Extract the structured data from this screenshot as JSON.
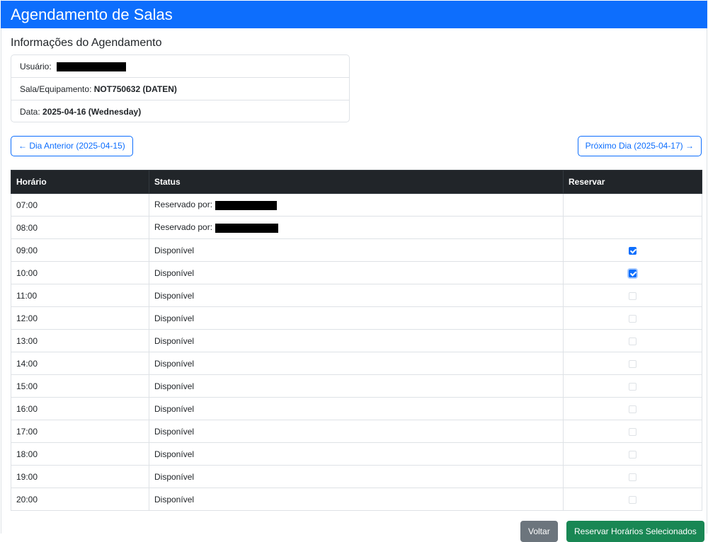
{
  "header": {
    "title": "Agendamento de Salas"
  },
  "info": {
    "section_title": "Informações do Agendamento",
    "user_label": "Usuário:",
    "room_label": "Sala/Equipamento:",
    "room_value": "NOT750632 (DATEN)",
    "date_label": "Data:",
    "date_value": "2025-04-16 (Wednesday)"
  },
  "nav": {
    "prev_label": "← Dia Anterior (2025-04-15)",
    "next_label": "Próximo Dia (2025-04-17) →"
  },
  "table": {
    "headers": [
      "Horário",
      "Status",
      "Reservar"
    ],
    "rows": [
      {
        "time": "07:00",
        "status": "Reservado por:",
        "reserved": true
      },
      {
        "time": "08:00",
        "status": "Reservado por:",
        "reserved": true
      },
      {
        "time": "09:00",
        "status": "Disponível",
        "checked": true
      },
      {
        "time": "10:00",
        "status": "Disponível",
        "checked": true
      },
      {
        "time": "11:00",
        "status": "Disponível",
        "checked": false
      },
      {
        "time": "12:00",
        "status": "Disponível",
        "checked": false
      },
      {
        "time": "13:00",
        "status": "Disponível",
        "checked": false
      },
      {
        "time": "14:00",
        "status": "Disponível",
        "checked": false
      },
      {
        "time": "15:00",
        "status": "Disponível",
        "checked": false
      },
      {
        "time": "16:00",
        "status": "Disponível",
        "checked": false
      },
      {
        "time": "17:00",
        "status": "Disponível",
        "checked": false
      },
      {
        "time": "18:00",
        "status": "Disponível",
        "checked": false
      },
      {
        "time": "19:00",
        "status": "Disponível",
        "checked": false
      },
      {
        "time": "20:00",
        "status": "Disponível",
        "checked": false
      }
    ]
  },
  "actions": {
    "back_label": "Voltar",
    "submit_label": "Reservar Horários Selecionados"
  },
  "colors": {
    "primary": "#0d6efd",
    "table_header": "#212529",
    "secondary": "#6c757d",
    "success": "#198754"
  }
}
